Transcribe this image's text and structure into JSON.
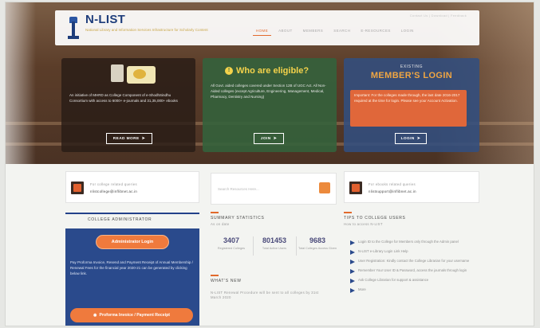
{
  "header": {
    "site_title": "N-LIST",
    "site_subtitle": "National Library and Information Services Infrastructure for Scholarly Content",
    "utility_links": "Contact Us | Download | Feedback",
    "nav": [
      "HOME",
      "ABOUT",
      "MEMBERS",
      "SEARCH",
      "E-RESOURCES",
      "LOGIN"
    ]
  },
  "hero": {
    "card_a": {
      "text": "An initiative of MHRD as College Component of e-ShodhSindhu Consortium with access to 6000+ e-journals and 31,35,000+ ebooks",
      "button": "READ MORE"
    },
    "card_b": {
      "title": "Who are eligible?",
      "text": "All Govt. aided colleges covered under Section 12B of UGC Act. All Non-Aided colleges (except Agriculture, Engineering, Management, Medical, Pharmacy, Dentistry and Nursing)",
      "button": "JOIN"
    },
    "card_c": {
      "kicker": "EXISTING",
      "title": "MEMBER'S LOGIN",
      "notice": "Important: For the colleges made through, the last date 2016-2017 required at the time for login. Please see your Account Activation.",
      "button": "LOGIN"
    }
  },
  "college_panel": {
    "contact_label": "For college related queries",
    "contact_email": "nlistcollege@inflibnet.ac.in",
    "heading": "COLLEGE ADMINISTRATOR",
    "login_button": "Administrator Login",
    "text": "Pay Proforma Invoice, Resend and Payment Receipt of Annual Membership / Renewal Fees for the financial year 2020-21 can be generated by clicking below link.",
    "pay_button": "Proforma Invoice / Payment Receipt"
  },
  "search": {
    "placeholder": "Search Resources Here..."
  },
  "statistics": {
    "heading": "SUMMARY STATISTICS",
    "subheading": "As on date",
    "items": [
      {
        "value": "3407",
        "label": "Registered Colleges"
      },
      {
        "value": "801453",
        "label": "Total Active Users"
      },
      {
        "value": "9683",
        "label": "Total Colleges Access Given"
      }
    ]
  },
  "whats_new": {
    "heading": "WHAT'S NEW",
    "text": "N-LIST Renewal Procedure will be sent to all colleges by 31st March 2020"
  },
  "queries_panel": {
    "contact_label": "For ebooks related queries",
    "contact_email": "nlistsupport@inflibnet.ac.in",
    "heading": "TIPS TO COLLEGE USERS",
    "subheading": "How to access N-LIST",
    "items": [
      "Login ID to the College for Members only through the Admin panel",
      "N-LIST e-Library Login Link Help",
      "User Registration: Kindly contact the College Librarian for your username",
      "Remember Your User ID & Password, access the journals through login",
      "Ask College Librarian for support & assistance",
      "More"
    ]
  },
  "colors": {
    "accent": "#e26a2c",
    "navy": "#1e3d7b",
    "panel_blue": "#2a4a8c"
  }
}
